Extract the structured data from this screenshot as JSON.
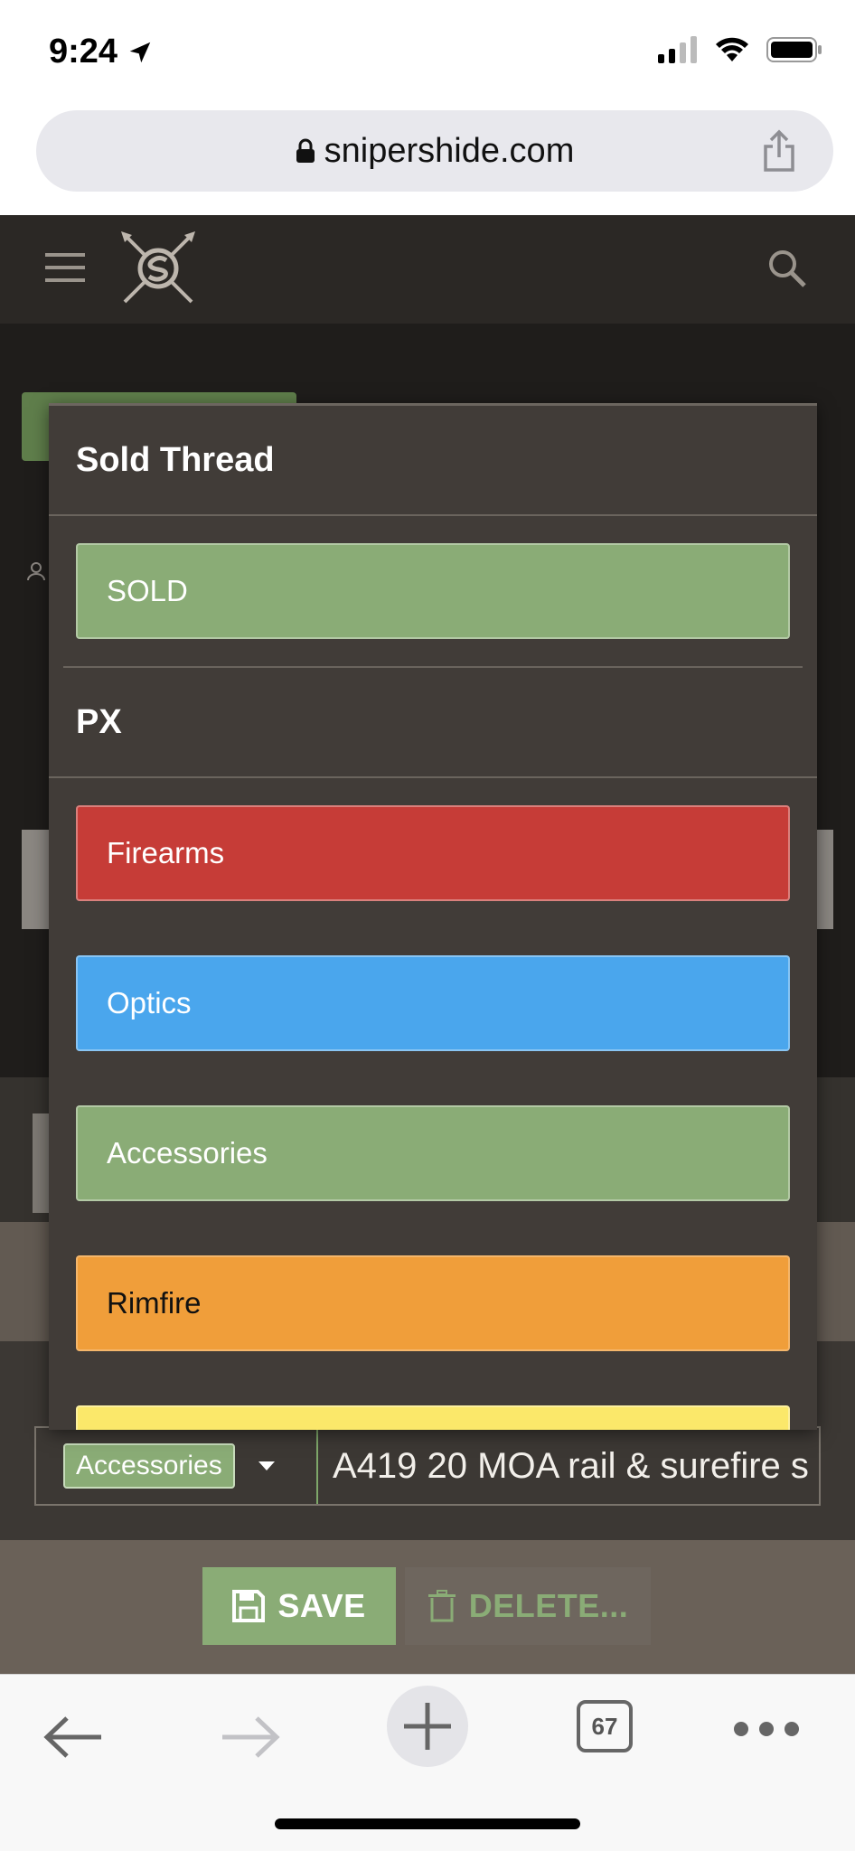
{
  "status_bar": {
    "time": "9:24",
    "icons": [
      "location-arrow-icon",
      "signal-icon",
      "wifi-icon",
      "battery-icon"
    ]
  },
  "browser": {
    "url": "snipershide.com",
    "icons": [
      "lock-icon",
      "share-icon"
    ]
  },
  "site_header": {
    "icons": [
      "hamburger-menu-icon",
      "snipershide-logo-icon",
      "search-icon"
    ]
  },
  "dropdown": {
    "groups": [
      {
        "label": "Sold Thread",
        "options": [
          "SOLD"
        ]
      },
      {
        "label": "PX",
        "options": [
          "Firearms",
          "Optics",
          "Accessories",
          "Rimfire",
          ""
        ]
      }
    ]
  },
  "title_row": {
    "prefix_value": "Accessories",
    "title_value": "A419 20 MOA rail & surefire s"
  },
  "actions": {
    "save_label": "SAVE",
    "delete_label": "DELETE..."
  },
  "safari_toolbar": {
    "tab_count": "67",
    "icons": [
      "back-arrow-icon",
      "forward-arrow-icon",
      "new-tab-plus-icon",
      "tabs-icon",
      "more-icon"
    ]
  },
  "colors": {
    "sold": "#8aac76",
    "firearms": "#c63c37",
    "optics": "#4aa6ed",
    "accessories": "#8aac76",
    "rimfire": "#f09e3a",
    "next": "#fbe86a",
    "header_bg": "#2b2825",
    "dropdown_bg": "#413c38"
  }
}
